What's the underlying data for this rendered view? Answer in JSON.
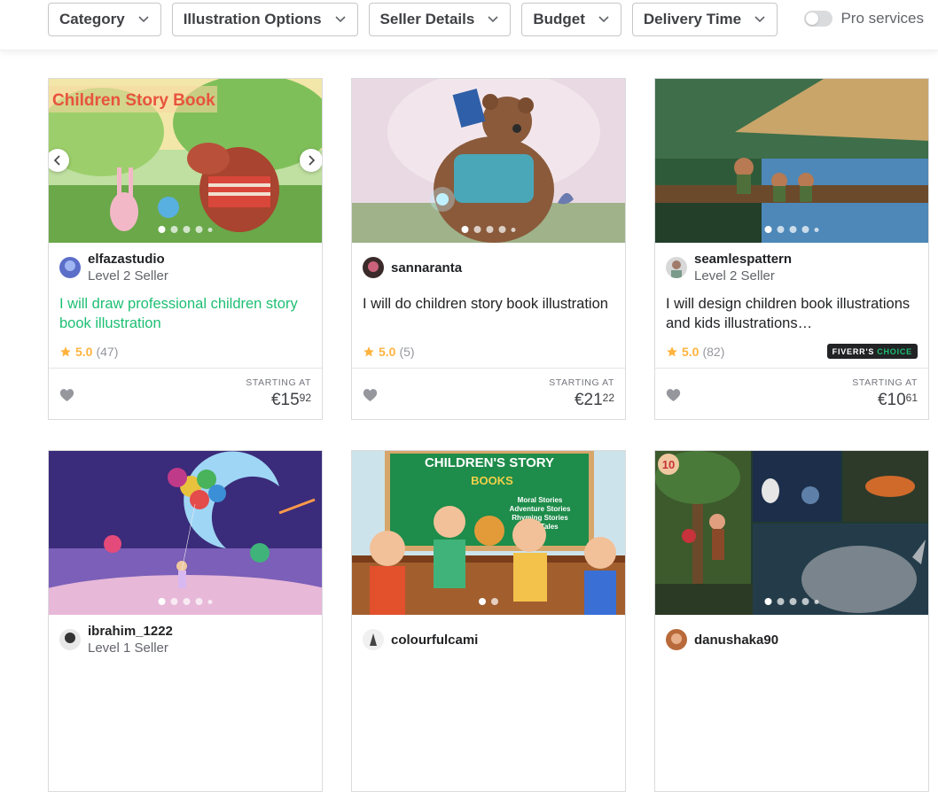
{
  "filters": [
    {
      "label": "Category"
    },
    {
      "label": "Illustration Options"
    },
    {
      "label": "Seller Details"
    },
    {
      "label": "Budget"
    },
    {
      "label": "Delivery Time"
    }
  ],
  "pro_services": {
    "label": "Pro services",
    "enabled": false
  },
  "colors": {
    "accent_green": "#1dbf73",
    "star": "#ffb33e",
    "text_dark": "#222325"
  },
  "gigs": [
    {
      "seller": "elfazastudio",
      "level": "Level 2 Seller",
      "title": "I will draw professional children story book illustration",
      "rating": "5.0",
      "reviews": "(47)",
      "start_label": "STARTING AT",
      "price_main": "€15",
      "price_cents": "92",
      "image_text": "Children Story Book"
    },
    {
      "seller": "sannaranta",
      "level": "",
      "title": "I will do children story book illustration",
      "rating": "5.0",
      "reviews": "(5)",
      "start_label": "STARTING AT",
      "price_main": "€21",
      "price_cents": "22"
    },
    {
      "seller": "seamlespattern",
      "level": "Level 2 Seller",
      "title": "I will design children book illustrations and kids illustrations…",
      "rating": "5.0",
      "reviews": "(82)",
      "badge_a": "FIVERR'S",
      "badge_b": "CHOICE",
      "start_label": "STARTING AT",
      "price_main": "€10",
      "price_cents": "61"
    },
    {
      "seller": "ibrahim_1222",
      "level": "Level 1 Seller"
    },
    {
      "seller": "colourfulcami",
      "level": "",
      "image_text_1": "CHILDREN'S STORY",
      "image_text_2": "BOOKS",
      "image_list": [
        "Moral Stories",
        "Adventure Stories",
        "Rhyming Stories",
        "Fairy Tales"
      ]
    },
    {
      "seller": "danushaka90",
      "level": "",
      "image_text": "10"
    }
  ]
}
